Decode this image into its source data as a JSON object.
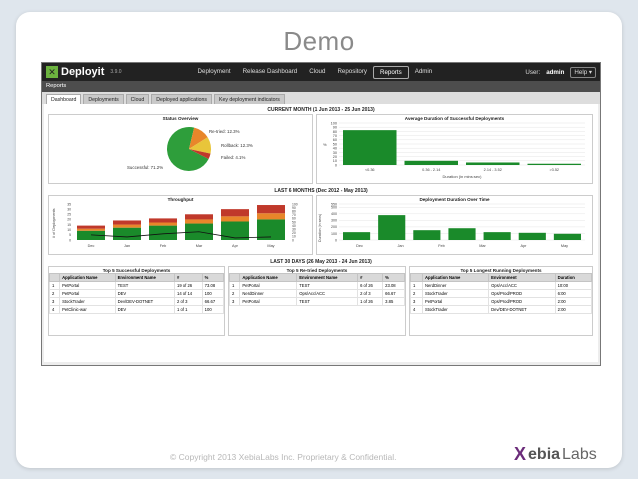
{
  "slide": {
    "title": "Demo",
    "footer": "© Copyright 2013 XebiaLabs Inc. Proprietary & Confidential.",
    "brand": {
      "x": "X",
      "ebia": "ebia",
      "labs": "Labs"
    }
  },
  "app": {
    "logo_text": "Deployit",
    "version": "3.9.0",
    "nav": [
      "Deployment",
      "Release Dashboard",
      "Cloud",
      "Repository",
      "Reports",
      "Admin"
    ],
    "active_nav": "Reports",
    "user_label": "User:",
    "user_name": "admin",
    "help_label": "Help",
    "reports_header": "Reports",
    "tabs": [
      "Dashboard",
      "Deployments",
      "Cloud",
      "Deployed applications",
      "Key deployment indicators"
    ],
    "active_tab": "Dashboard"
  },
  "sections": {
    "current_month": "CURRENT MONTH (1 Jun 2013 - 25 Jun 2013)",
    "last_6_months": "LAST 6 MONTHS (Dec 2012 - May 2013)",
    "last_30_days": "LAST 30 DAYS (26 May 2013 - 24 Jun 2013)"
  },
  "chart_data": [
    {
      "type": "pie",
      "title": "Status Overview",
      "slices": [
        {
          "label": "Successful: 71.2%",
          "value": 71.2,
          "color": "#2e9e3b"
        },
        {
          "label": "Re-tried: 12.3%",
          "value": 12.3,
          "color": "#e8862a"
        },
        {
          "label": "Rollback: 12.3%",
          "value": 12.3,
          "color": "#e8c53a"
        },
        {
          "label": "Failed: 4.1%",
          "value": 4.1,
          "color": "#c0392b"
        }
      ]
    },
    {
      "type": "bar",
      "title": "Average Duration of Successful Deployments",
      "categories": [
        "<0.36",
        "0.36 - 2.14",
        "2.14 - 3.52",
        ">3.52"
      ],
      "values": [
        83,
        10,
        6,
        3
      ],
      "xlabel": "Duration (in mins:sec)",
      "ylabel": "%",
      "ylim": [
        0,
        100
      ],
      "yticks": [
        0,
        10,
        20,
        30,
        40,
        50,
        60,
        70,
        80,
        90,
        100
      ],
      "color": "#1a8a2a"
    },
    {
      "type": "bar",
      "title": "Throughput",
      "categories": [
        "Dec",
        "Jan",
        "Feb",
        "Mar",
        "Apr",
        "May"
      ],
      "series": [
        {
          "values": [
            9,
            12,
            14,
            16,
            18,
            20
          ],
          "color": "#1a8a2a"
        },
        {
          "values": [
            2,
            3,
            3,
            4,
            5,
            6
          ],
          "color": "#e8862a"
        },
        {
          "values": [
            3,
            4,
            4,
            5,
            7,
            8
          ],
          "color": "#c0392b"
        }
      ],
      "line": [
        5,
        3,
        6,
        8,
        2,
        3
      ],
      "ylabel": "# of Deployments",
      "yticks": [
        0,
        5,
        10,
        15,
        20,
        25,
        30,
        35
      ],
      "ylim": [
        0,
        35
      ],
      "right_yticks": [
        "0",
        "10",
        "20",
        "30",
        "40",
        "50",
        "60",
        "70",
        "80",
        "90",
        "100"
      ]
    },
    {
      "type": "bar",
      "title": "Deployment Duration Over Time",
      "categories": [
        "Dec",
        "Jan",
        "Feb",
        "Mar",
        "Apr",
        "May"
      ],
      "values": [
        120,
        380,
        150,
        180,
        120,
        110,
        95
      ],
      "ylabel": "Duration (in secs)",
      "yticks": [
        0,
        50,
        100,
        150,
        200,
        250,
        300,
        350,
        400,
        450,
        500,
        550
      ],
      "ylim": [
        0,
        550
      ],
      "color": "#1a8a2a"
    }
  ],
  "tables": {
    "successful": {
      "title": "Top 5 Successful Deployments",
      "headers": [
        "",
        "Application Name",
        "Environment Name",
        "#",
        "%"
      ],
      "rows": [
        [
          "1",
          "PetPortal",
          "TEST",
          "19 of 26",
          "73.08"
        ],
        [
          "2",
          "PetPortal",
          "DEV",
          "14 of 14",
          "100"
        ],
        [
          "3",
          "StockTrader",
          "Dev/DEV-DOTNET",
          "2 of 3",
          "66.67"
        ],
        [
          "4",
          "PetClinic-war",
          "DEV",
          "1 of 1",
          "100"
        ]
      ]
    },
    "retried": {
      "title": "Top 5 Re-tried Deployments",
      "headers": [
        "",
        "Application Name",
        "Environment Name",
        "#",
        "%"
      ],
      "rows": [
        [
          "1",
          "PetPortal",
          "TEST",
          "6 of 26",
          "23.08"
        ],
        [
          "2",
          "NerdDinner",
          "Ops/Acc/ACC",
          "2 of 3",
          "66.67"
        ],
        [
          "3",
          "PetPortal",
          "TEST",
          "1 of 26",
          "3.85"
        ]
      ]
    },
    "longest": {
      "title": "Top 5 Longest Running Deployments",
      "headers": [
        "",
        "Application Name",
        "Environment",
        "Duration"
      ],
      "rows": [
        [
          "1",
          "NerdDinner",
          "Ops/Acc/ACC",
          "10:00"
        ],
        [
          "2",
          "StockTrader",
          "Ops/Prod/PROD",
          "6:00"
        ],
        [
          "3",
          "PetPortal",
          "Ops/Prod/PROD",
          "2:00"
        ],
        [
          "4",
          "StockTrader",
          "Dev/DEV-DOTNET",
          "2:00"
        ]
      ]
    }
  }
}
